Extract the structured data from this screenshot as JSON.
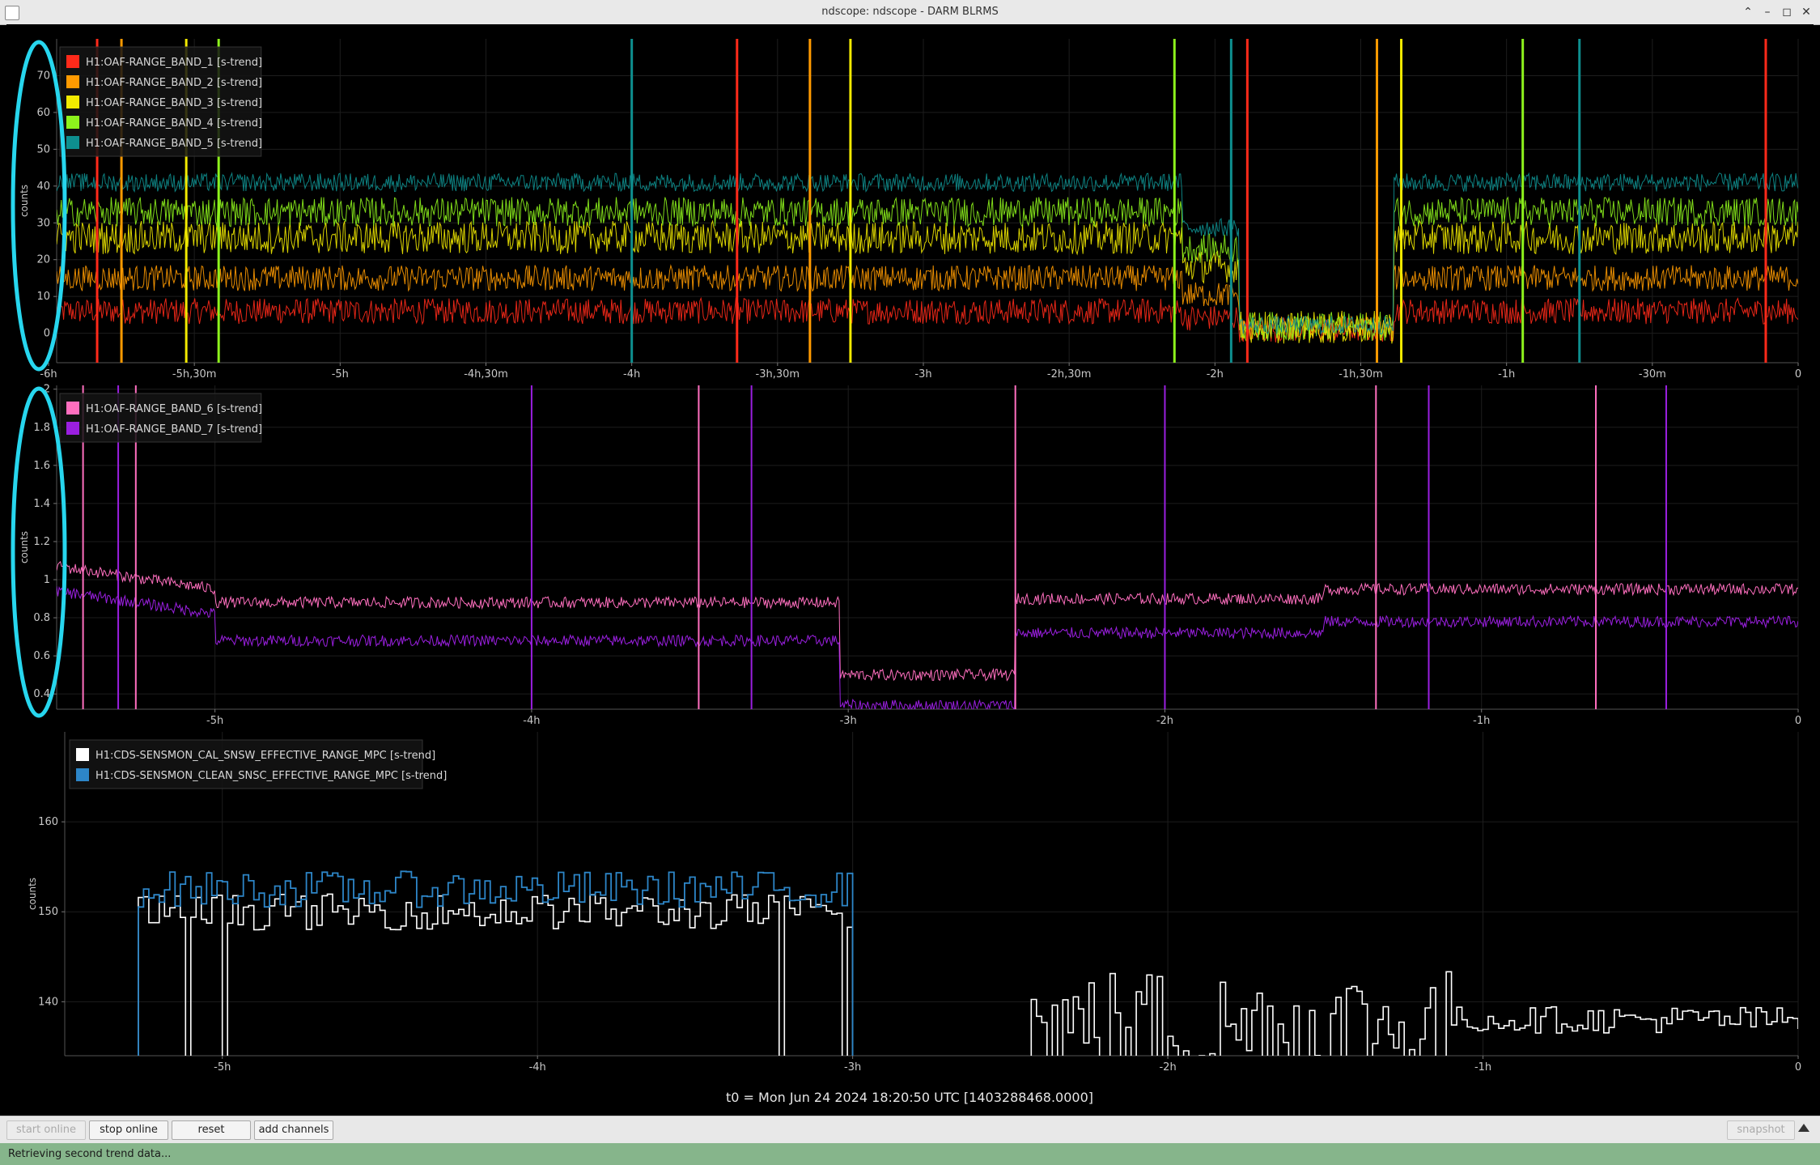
{
  "window": {
    "title": "ndscope: ndscope - DARM BLRMS",
    "controls": [
      "minimize-icon",
      "restore-icon",
      "maximize-icon",
      "close-icon"
    ]
  },
  "plots": [
    {
      "ylabel": "counts",
      "yticks": [
        "0",
        "10",
        "20",
        "30",
        "40",
        "50",
        "60",
        "70"
      ],
      "yrange": [
        -8,
        80
      ],
      "xticks": [
        {
          "t": -21600,
          "label": "-6h"
        },
        {
          "t": -19800,
          "label": "-5h,30m"
        },
        {
          "t": -18000,
          "label": "-5h"
        },
        {
          "t": -16200,
          "label": "-4h,30m"
        },
        {
          "t": -14400,
          "label": "-4h"
        },
        {
          "t": -12600,
          "label": "-3h,30m"
        },
        {
          "t": -10800,
          "label": "-3h"
        },
        {
          "t": -9000,
          "label": "-2h,30m"
        },
        {
          "t": -7200,
          "label": "-2h"
        },
        {
          "t": -5400,
          "label": "-1h,30m"
        },
        {
          "t": -3600,
          "label": "-1h"
        },
        {
          "t": -1800,
          "label": "-30m"
        },
        {
          "t": 0,
          "label": "0"
        }
      ],
      "legend": [
        {
          "label": "H1:OAF-RANGE_BAND_1 [s-trend]",
          "color": "#ff2a1a"
        },
        {
          "label": "H1:OAF-RANGE_BAND_2 [s-trend]",
          "color": "#ff9a00"
        },
        {
          "label": "H1:OAF-RANGE_BAND_3 [s-trend]",
          "color": "#f2ea00"
        },
        {
          "label": "H1:OAF-RANGE_BAND_4 [s-trend]",
          "color": "#8df21c"
        },
        {
          "label": "H1:OAF-RANGE_BAND_5 [s-trend]",
          "color": "#0e8f8f"
        }
      ]
    },
    {
      "ylabel": "counts",
      "yticks": [
        "0.4",
        "0.6",
        "0.8",
        "1",
        "1.2",
        "1.4",
        "1.6",
        "1.8",
        "2"
      ],
      "yrange": [
        0.32,
        2.02
      ],
      "xticks": [
        {
          "t": -18000,
          "label": "-5h"
        },
        {
          "t": -14400,
          "label": "-4h"
        },
        {
          "t": -10800,
          "label": "-3h"
        },
        {
          "t": -7200,
          "label": "-2h"
        },
        {
          "t": -3600,
          "label": "-1h"
        },
        {
          "t": 0,
          "label": "0"
        }
      ],
      "legend": [
        {
          "label": "H1:OAF-RANGE_BAND_6 [s-trend]",
          "color": "#ff6fbf"
        },
        {
          "label": "H1:OAF-RANGE_BAND_7 [s-trend]",
          "color": "#9a1fe0"
        }
      ]
    },
    {
      "ylabel": "counts",
      "yticks": [
        "140",
        "150",
        "160"
      ],
      "yrange": [
        134,
        170
      ],
      "xticks": [
        {
          "t": -18000,
          "label": "-5h"
        },
        {
          "t": -14400,
          "label": "-4h"
        },
        {
          "t": -10800,
          "label": "-3h"
        },
        {
          "t": -7200,
          "label": "-2h"
        },
        {
          "t": -3600,
          "label": "-1h"
        },
        {
          "t": 0,
          "label": "0"
        }
      ],
      "legend": [
        {
          "label": "H1:CDS-SENSMON_CAL_SNSW_EFFECTIVE_RANGE_MPC [s-trend]",
          "color": "#ffffff"
        },
        {
          "label": "H1:CDS-SENSMON_CLEAN_SNSC_EFFECTIVE_RANGE_MPC [s-trend]",
          "color": "#2d86c8"
        }
      ]
    }
  ],
  "t0_text": "t0 = Mon Jun 24 2024 18:20:50 UTC [1403288468.0000]",
  "toolbar": {
    "start_online": "start online",
    "stop_online": "stop online",
    "reset": "reset",
    "add_channels": "add channels",
    "snapshot": "snapshot"
  },
  "status": "Retrieving second trend data...",
  "annotation_color": "#27d6ee"
}
